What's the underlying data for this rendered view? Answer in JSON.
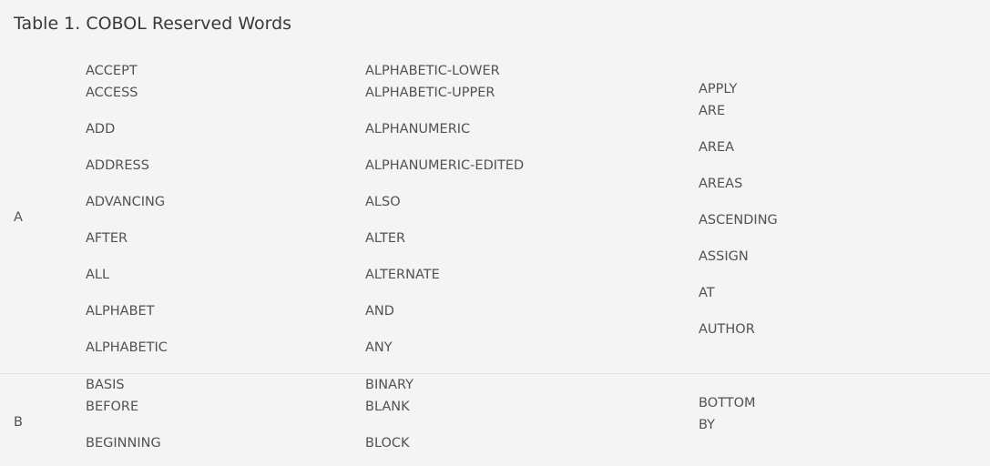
{
  "caption": "Table 1. COBOL Reserved Words",
  "rows": [
    {
      "letter": "A",
      "col1": [
        "ACCEPT",
        "ACCESS",
        "ADD",
        "ADDRESS",
        "ADVANCING",
        "AFTER",
        "ALL",
        "ALPHABET",
        "ALPHABETIC"
      ],
      "col2": [
        "ALPHABETIC-LOWER",
        "ALPHABETIC-UPPER",
        "ALPHANUMERIC",
        "ALPHANUMERIC-EDITED",
        "ALSO",
        "ALTER",
        "ALTERNATE",
        "AND",
        "ANY"
      ],
      "col3": [
        "APPLY",
        "ARE",
        "AREA",
        "AREAS",
        "ASCENDING",
        "ASSIGN",
        "AT",
        "AUTHOR"
      ]
    },
    {
      "letter": "B",
      "col1": [
        "BASIS",
        "BEFORE",
        "BEGINNING"
      ],
      "col2": [
        "BINARY",
        "BLANK",
        "BLOCK"
      ],
      "col3": [
        "BOTTOM",
        "BY"
      ]
    }
  ]
}
